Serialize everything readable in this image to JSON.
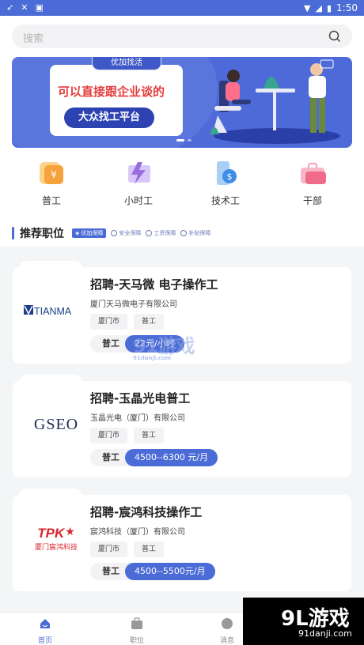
{
  "statusbar": {
    "time": "1:50"
  },
  "search": {
    "placeholder": "搜索"
  },
  "banner": {
    "tag": "优加找活",
    "headline": "可以直接跟企业谈的",
    "button": "大众找工平台"
  },
  "categories": [
    {
      "label": "普工",
      "icon": "piggy-bank-icon",
      "color": "#f5a33a"
    },
    {
      "label": "小时工",
      "icon": "lightning-icon",
      "color": "#9b6ee0"
    },
    {
      "label": "技术工",
      "icon": "phone-dollar-icon",
      "color": "#3f8de6"
    },
    {
      "label": "干部",
      "icon": "briefcase-icon",
      "color": "#f06a8a"
    }
  ],
  "section": {
    "title": "推荐职位",
    "badge": "优加保障",
    "guarantees": [
      "安全保障",
      "工资保障",
      "补贴保障"
    ]
  },
  "jobs": [
    {
      "logo_text": "TIANMA",
      "title": "招聘-天马微 电子操作工",
      "company": "厦门天马微电子有限公司",
      "location": "厦门市",
      "type": "普工",
      "pay_type": "普工",
      "pay": "22元/小时"
    },
    {
      "logo_text": "GSEO",
      "title": "招聘-玉晶光电普工",
      "company": "玉晶光电（厦门）有限公司",
      "location": "厦门市",
      "type": "普工",
      "pay_type": "普工",
      "pay": "4500--6300 元/月"
    },
    {
      "logo_text": "TPK",
      "logo_sub": "厦门宸鸿科技",
      "title": "招聘-宸鸿科技操作工",
      "company": "宸鸿科技（厦门）有限公司",
      "location": "厦门市",
      "type": "普工",
      "pay_type": "普工",
      "pay": "4500--5500元/月"
    }
  ],
  "nav": [
    {
      "label": "首页",
      "icon": "home-icon"
    },
    {
      "label": "职位",
      "icon": "briefcase-icon"
    },
    {
      "label": "消息",
      "icon": "chat-icon"
    }
  ],
  "watermark": {
    "center": "91游戏",
    "center_url": "91danji.com",
    "corner": "9L游戏",
    "corner_url": "91danji.com"
  },
  "colors": {
    "primary": "#4b6bd6",
    "banner_red": "#e53c3c"
  }
}
